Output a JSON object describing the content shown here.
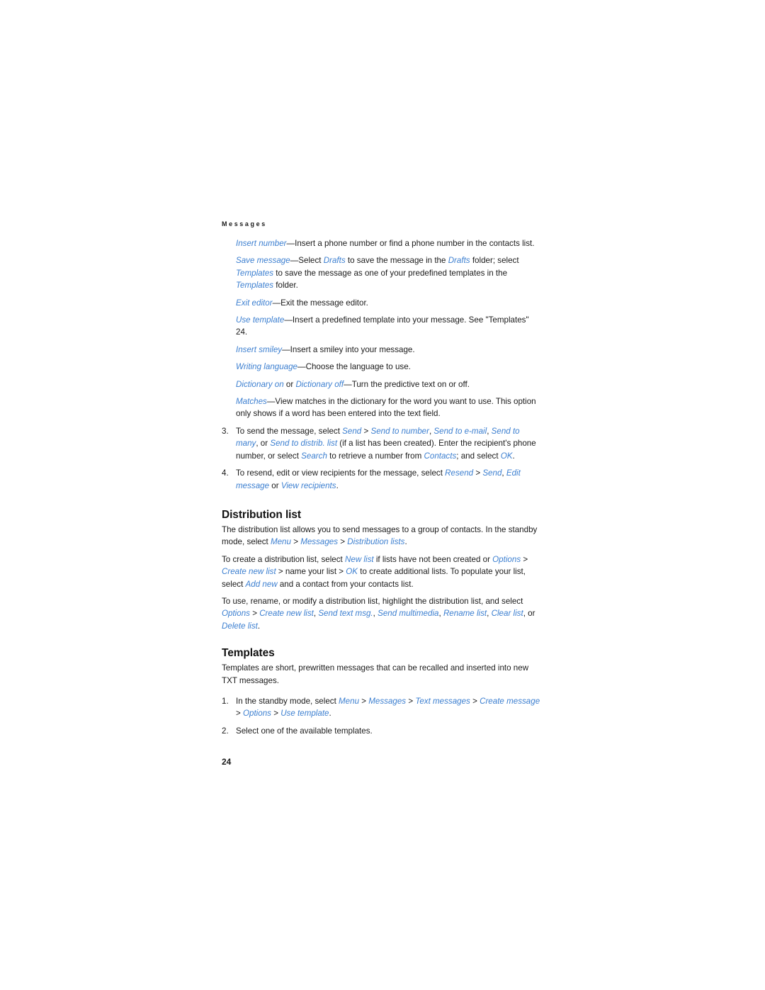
{
  "document": {
    "running_header": "Messages",
    "page_number": "24",
    "accent_color": "#3c7fd0",
    "text_color": "#1a1a1a",
    "background": "#ffffff"
  },
  "options_list": [
    {
      "term": "Insert number",
      "dash": "—",
      "text": "Insert a phone number or find a phone number in the contacts list."
    },
    {
      "term": "Save message",
      "dash": "—",
      "text_parts": [
        {
          "t": "Select ",
          "ui": false
        },
        {
          "t": "Drafts",
          "ui": true
        },
        {
          "t": " to save the message in the ",
          "ui": false
        },
        {
          "t": "Drafts",
          "ui": true
        },
        {
          "t": " folder; select ",
          "ui": false
        },
        {
          "t": "Templates",
          "ui": true
        },
        {
          "t": " to save the message as one of your predefined templates in the ",
          "ui": false
        },
        {
          "t": "Templates",
          "ui": true
        },
        {
          "t": " folder.",
          "ui": false
        }
      ]
    },
    {
      "term": "Exit editor",
      "dash": "—",
      "text": "Exit the message editor."
    },
    {
      "term": "Use template",
      "dash": "—",
      "text": "Insert a predefined template into your message. See \"Templates\" 24."
    },
    {
      "term": "Insert smiley",
      "dash": "—",
      "text": "Insert a smiley into your message."
    },
    {
      "term": "Writing language",
      "dash": "—",
      "text": "Choose the language to use."
    },
    {
      "term": "Dictionary on",
      "term2": "Dictionary off",
      "joiner": " or ",
      "dash": "—",
      "text": "Turn the predictive text on or off."
    },
    {
      "term": "Matches",
      "dash": "—",
      "text": "View matches in the dictionary for the word you want to use. This option only shows if a word has been entered into the text field."
    }
  ],
  "steps_top": [
    {
      "number": "3.",
      "parts": [
        {
          "t": "To send the message, select ",
          "ui": false
        },
        {
          "t": "Send",
          "ui": true
        },
        {
          "t": " > ",
          "ui": false
        },
        {
          "t": "Send to number",
          "ui": true
        },
        {
          "t": ", ",
          "ui": false
        },
        {
          "t": "Send to e-mail",
          "ui": true
        },
        {
          "t": ", ",
          "ui": false
        },
        {
          "t": "Send to many",
          "ui": true
        },
        {
          "t": ", or ",
          "ui": false
        },
        {
          "t": "Send to distrib. list",
          "ui": true
        },
        {
          "t": " (if a list has been created). Enter the recipient's phone number, or select ",
          "ui": false
        },
        {
          "t": "Search",
          "ui": true
        },
        {
          "t": " to retrieve a number from ",
          "ui": false
        },
        {
          "t": "Contacts",
          "ui": true
        },
        {
          "t": "; and select ",
          "ui": false
        },
        {
          "t": "OK",
          "ui": true
        },
        {
          "t": ".",
          "ui": false
        }
      ]
    },
    {
      "number": "4.",
      "parts": [
        {
          "t": "To resend, edit or view recipients for the message, select ",
          "ui": false
        },
        {
          "t": "Resend",
          "ui": true
        },
        {
          "t": " > ",
          "ui": false
        },
        {
          "t": "Send",
          "ui": true
        },
        {
          "t": ", ",
          "ui": false
        },
        {
          "t": "Edit message",
          "ui": true
        },
        {
          "t": " or ",
          "ui": false
        },
        {
          "t": "View recipients",
          "ui": true
        },
        {
          "t": ".",
          "ui": false
        }
      ]
    }
  ],
  "distribution_list": {
    "heading": "Distribution list",
    "paragraphs": [
      [
        {
          "t": "The distribution list allows you to send messages to a group of contacts. In the standby mode, select ",
          "ui": false
        },
        {
          "t": "Menu",
          "ui": true
        },
        {
          "t": " > ",
          "ui": false
        },
        {
          "t": "Messages",
          "ui": true
        },
        {
          "t": " > ",
          "ui": false
        },
        {
          "t": "Distribution lists",
          "ui": true
        },
        {
          "t": ".",
          "ui": false
        }
      ],
      [
        {
          "t": "To create a distribution list, select ",
          "ui": false
        },
        {
          "t": "New list",
          "ui": true
        },
        {
          "t": " if lists have not been created or ",
          "ui": false
        },
        {
          "t": "Options",
          "ui": true
        },
        {
          "t": " > ",
          "ui": false
        },
        {
          "t": "Create new list",
          "ui": true
        },
        {
          "t": " > name your list > ",
          "ui": false
        },
        {
          "t": "OK",
          "ui": true
        },
        {
          "t": " to create additional lists. To populate your list, select ",
          "ui": false
        },
        {
          "t": "Add new",
          "ui": true
        },
        {
          "t": " and a contact from your contacts list.",
          "ui": false
        }
      ],
      [
        {
          "t": "To use, rename, or modify a distribution list, highlight the distribution list, and select ",
          "ui": false
        },
        {
          "t": "Options",
          "ui": true
        },
        {
          "t": " > ",
          "ui": false
        },
        {
          "t": "Create new list",
          "ui": true
        },
        {
          "t": ", ",
          "ui": false
        },
        {
          "t": "Send text msg.",
          "ui": true
        },
        {
          "t": ", ",
          "ui": false
        },
        {
          "t": "Send multimedia",
          "ui": true
        },
        {
          "t": ", ",
          "ui": false
        },
        {
          "t": "Rename list",
          "ui": true
        },
        {
          "t": ", ",
          "ui": false
        },
        {
          "t": "Clear list",
          "ui": true
        },
        {
          "t": ", or ",
          "ui": false
        },
        {
          "t": "Delete list",
          "ui": true
        },
        {
          "t": ".",
          "ui": false
        }
      ]
    ]
  },
  "templates": {
    "heading": "Templates",
    "intro": "Templates are short, prewritten messages that can be recalled and inserted into new TXT messages.",
    "steps": [
      {
        "number": "1.",
        "parts": [
          {
            "t": "In the standby mode, select ",
            "ui": false
          },
          {
            "t": "Menu",
            "ui": true
          },
          {
            "t": " > ",
            "ui": false
          },
          {
            "t": "Messages",
            "ui": true
          },
          {
            "t": " > ",
            "ui": false
          },
          {
            "t": "Text messages",
            "ui": true
          },
          {
            "t": " > ",
            "ui": false
          },
          {
            "t": "Create message",
            "ui": true
          },
          {
            "t": " > ",
            "ui": false
          },
          {
            "t": "Options",
            "ui": true
          },
          {
            "t": " > ",
            "ui": false
          },
          {
            "t": "Use template",
            "ui": true
          },
          {
            "t": ".",
            "ui": false
          }
        ]
      },
      {
        "number": "2.",
        "parts": [
          {
            "t": "Select one of the available templates.",
            "ui": false
          }
        ]
      }
    ]
  }
}
